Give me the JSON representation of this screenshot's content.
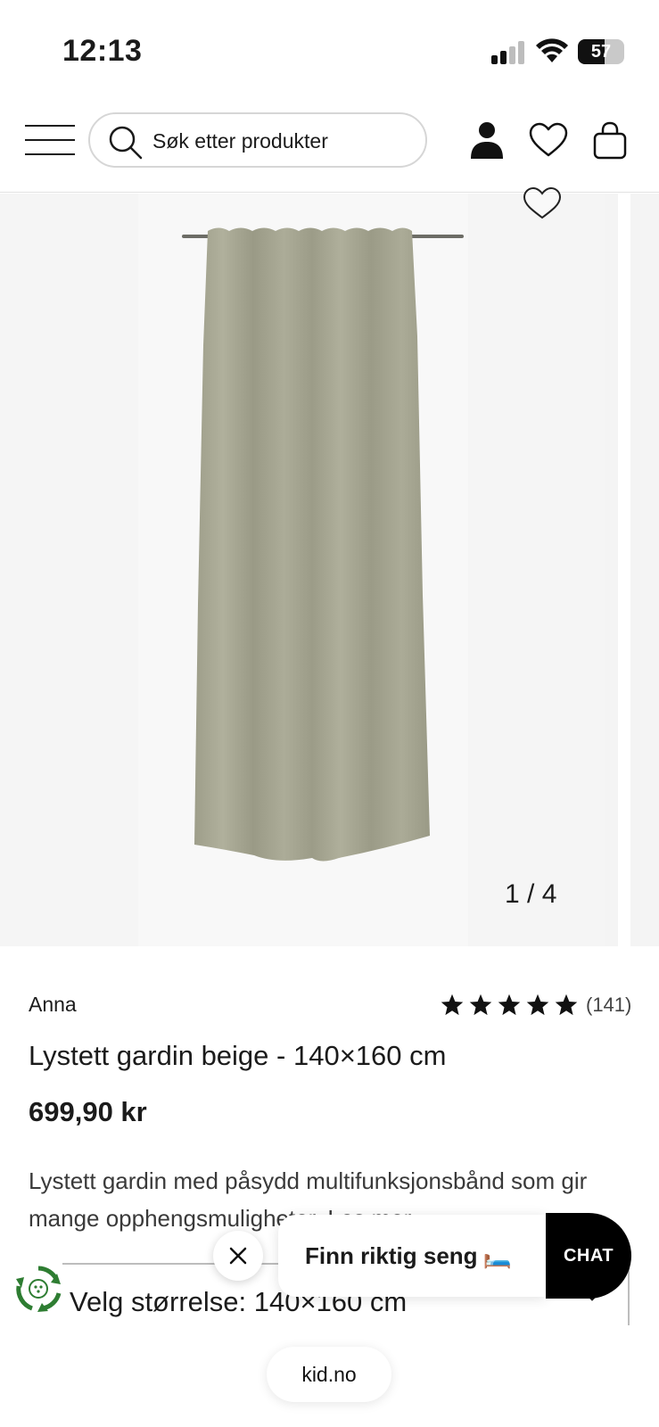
{
  "status_bar": {
    "time": "12:13",
    "battery": "57"
  },
  "header": {
    "search_placeholder": "Søk etter produkter"
  },
  "gallery": {
    "counter": "1 / 4"
  },
  "product": {
    "brand": "Anna",
    "rating_value": 5,
    "rating_count": "(141)",
    "title": "Lystett gardin beige - 140×160 cm",
    "price": "699,90 kr",
    "description": "Lystett gardin med påsydd multifunksjonsbånd som gir mange opphengsmuligheter.",
    "read_more": "Les mer",
    "size_label": "Velg størrelse: 140×160 cm"
  },
  "overlays": {
    "promo_text": "Finn riktig seng",
    "promo_emoji": "🛏️",
    "chat_label": "CHAT"
  },
  "browser": {
    "url": "kid.no"
  },
  "colors": {
    "accent_dark": "#000000",
    "eco_green": "#2e7d32",
    "curtain": "#a8a894"
  }
}
